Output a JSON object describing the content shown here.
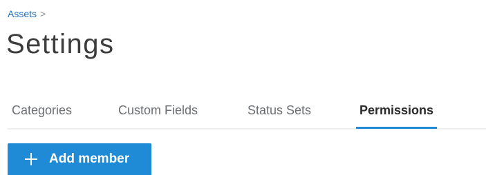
{
  "breadcrumb": {
    "parent": "Assets",
    "separator": ">"
  },
  "page": {
    "title": "Settings"
  },
  "tabs": [
    {
      "label": "Categories",
      "active": false
    },
    {
      "label": "Custom Fields",
      "active": false
    },
    {
      "label": "Status Sets",
      "active": false
    },
    {
      "label": "Permissions",
      "active": true
    }
  ],
  "actions": {
    "add_member_label": "Add member",
    "add_member_icon": "plus-icon"
  },
  "colors": {
    "accent": "#1f8ad6",
    "link": "#1f6fbf",
    "tab_inactive": "#6b6f73",
    "tab_active": "#2a2a2a",
    "title": "#3c3c3c"
  }
}
